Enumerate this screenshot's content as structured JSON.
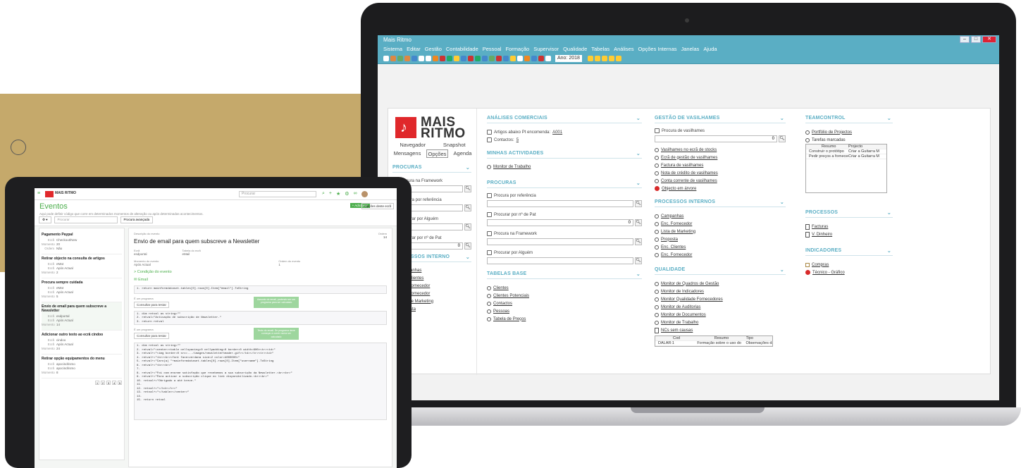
{
  "laptop": {
    "window_title": "Mais Ritmo",
    "menu": [
      "Sistema",
      "Editar",
      "Gestão",
      "Contabilidade",
      "Pessoal",
      "Formação",
      "Supervisor",
      "Qualidade",
      "Tabelas",
      "Análises",
      "Opções Internas",
      "Janelas",
      "Ajuda"
    ],
    "toolbar_year": "Ano: 2018",
    "logo": {
      "line1": "MAIS",
      "line2": "RITMO"
    },
    "left_tabs": {
      "row1": [
        "Navegador",
        "Snapshot"
      ],
      "row2": [
        "Mensagens",
        "Opções",
        "Agenda"
      ]
    },
    "procuras_title": "PROCURAS",
    "procuras": [
      {
        "label": "Procura na Framework",
        "value": ""
      },
      {
        "label": "Procura por referência",
        "value": ""
      },
      {
        "label": "Procurar por Alguém",
        "value": ""
      },
      {
        "label": "Procurar por nº de Pat",
        "value": "0"
      }
    ],
    "processos_interno_title": "PROCESSOS INTERNO",
    "processos_interno_items": [
      "Campanhas",
      "Enc. Clientes",
      "Enc. Fornecedor",
      "Enc. Fornecedor",
      "Lista de Marketing",
      "Proposta"
    ],
    "col1": {
      "analises_title": "ANÁLISES COMERCIAIS",
      "analises": [
        {
          "text": "Artigos abaixo Pt encomenda: ",
          "link": "A001"
        },
        {
          "text": "Contactos: ",
          "link": "5"
        }
      ],
      "minhas_title": "MINHAS ACTIVIDADES",
      "minhas": [
        "Monitor de Trabalho"
      ],
      "procuras_title": "PROCURAS",
      "procuras": [
        {
          "label": "Procura por referência",
          "value": ""
        },
        {
          "label": "Procurar por nº de Pat",
          "value": "0"
        },
        {
          "label": "Procura na Framework",
          "value": ""
        },
        {
          "label": "Procurar por Alguém",
          "value": ""
        }
      ],
      "tabelas_title": "TABELAS BASE",
      "tabelas": [
        "Clientes",
        "Clientes Potenciais",
        "Contactos",
        "Pessoas",
        "Tabela de Preços"
      ]
    },
    "col2": {
      "vasilhames_title": "GESTÃO DE VASILHAMES",
      "vasilhames_search_label": "Procura de vasilhames",
      "vasilhames_search_value": "0",
      "vasilhames": [
        "Vasilhames no ecrã de stocks",
        "Ecrã de gestão de vasilhames",
        "Factura de vasilhames",
        "Nota de crédito de vasilhames",
        "Conta corrente de vasilhames"
      ],
      "vasilhames_err": "Objecto em árvore",
      "processos_title": "PROCESSOS INTERNOS",
      "processos": [
        "Campanhas",
        "Enc. Fornecedor",
        "Lista de Marketing",
        "Proposta",
        "Enc. Clientes",
        "Enc. Fornecedor"
      ],
      "qualidade_title": "QUALIDADE",
      "qualidade": [
        "Monitor de Quadros de Gestão",
        "Monitor de Indicadores",
        "Monitor Qualidade Fornecedores",
        "Monitor de Auditorias",
        "Monitor de Documentos",
        "Monitor de Trabalho"
      ],
      "ncs_label": "NCs sem causas",
      "ncs_headers": [
        "Cod",
        "Resumo",
        "Tipo"
      ],
      "ncs_rows": [
        [
          "DALAR:1",
          "Formação sobre o uso do",
          "Observações da"
        ]
      ]
    },
    "col3": {
      "teamcontrol_title": "TEAMCONTROL",
      "portfolio": "Portfólio de Projectos",
      "tarefas": "Tarefas marcadas",
      "tarefas_headers": [
        "Resumo",
        "Projecto"
      ],
      "tarefas_rows": [
        [
          "Construir o protótipo",
          "Criar a Guitarra M"
        ],
        [
          "Pedir preços a fornecedor",
          "Criar a Guitarra M"
        ]
      ],
      "processos_title": "PROCESSOS",
      "processos": [
        "Facturas",
        "V. Dinheiro"
      ],
      "indicadores_title": "INDICADORES",
      "indicadores": [
        {
          "text": "Compras",
          "type": "doc"
        },
        {
          "text": "Técnico - Gráfico",
          "type": "err"
        }
      ]
    }
  },
  "tablet": {
    "brand": "MAIS RITMO",
    "search_placeholder": "Procurar",
    "page_title": "Eventos",
    "page_subtitle": "Aqui pode definir código que corre em determinados momentos de alteração ou após determinadas acontecimentos.",
    "btn_add": "+ Adicionar",
    "btn_options": "Opções deste ecrã",
    "filter_placeholder": "Procurar",
    "filter_btn": "Procura avançada",
    "events": [
      {
        "title": "Pagamento Paypal",
        "kv": [
          [
            "Ecrã",
            "Checkout/New"
          ],
          [
            "Momento",
            "20"
          ],
          [
            "Ordem",
            "Não"
          ]
        ]
      },
      {
        "title": "Retirar objecto na consulta de artigos",
        "kv": [
          [
            "Ecrã",
            "eMat"
          ],
          [
            "Ecrã",
            "Após Actual"
          ],
          [
            "Momento",
            "2"
          ]
        ]
      },
      {
        "title": "Procura sempre cuidada",
        "kv": [
          [
            "Ecrã",
            "eMat"
          ],
          [
            "Ecrã",
            "Após Actual"
          ],
          [
            "Momento",
            "5"
          ]
        ]
      },
      {
        "title": "Envio de email para quem subscreve a Newsletter",
        "kv": [
          [
            "Ecrã",
            "esdportal"
          ],
          [
            "Ecrã",
            "Após Actual"
          ],
          [
            "Momento",
            "14"
          ]
        ]
      },
      {
        "title": "Adicionar outro texto ao ecrã cindoo",
        "kv": [
          [
            "Ecrã",
            "cindoo"
          ],
          [
            "Ecrã",
            "Após Actual"
          ],
          [
            "Momento",
            "24"
          ]
        ]
      },
      {
        "title": "Retirar opção equipamentos do menu",
        "kv": [
          [
            "Ecrã",
            "apocindrismo"
          ],
          [
            "Ecrã",
            "apocindrismo"
          ],
          [
            "Momento",
            "8"
          ]
        ]
      }
    ],
    "pager": [
      "1",
      "2",
      "3",
      "4",
      "5"
    ],
    "detail": {
      "desc_label": "Descrição do evento",
      "title": "Envio de email para quem subscreve a Newsletter",
      "order_label": "Ordem",
      "order": "14",
      "screen_label": "Ecrã",
      "screen": "esdportal",
      "table_label": "Tabela do ecrã",
      "table": "eMail",
      "moment_label": "Momento do evento",
      "moment": "Após Actual",
      "type_label": "Ordem do evento",
      "type": "1",
      "condition": "Condição do evento",
      "email": "Email",
      "code1": "1. return mainformdataset.tables[0].rows[0].Item[\"email\"].ToString",
      "program_label": "É um programa",
      "consult_btn": "Consultar para testar",
      "code2": "1. dim retval as string=\"\"\n2. retval=\"Activação de subscrição de Newsletter.\"\n3. return retval",
      "badge1": "Assunto do email, podendo ser um programa para ser calculado",
      "badge2": "Texto do email. Se programa deve começar a correr numa ser calculado",
      "code3": "1. dim retval as string=\"\"\n2. retval=\"<center><table cellspacing=0 cellpadding=0 border=0 width=600><tr><td>\"\n3. retval+=\"<img border=0 src=.../images/newsletterheader.gif></td></tr><tr><td>\"\n4. retval+=\"<br><br><font face=verdana size=2 color=#000000>\"\n5. retval+=\"Caro(a) \"+mainformdataset.tables[0].rows[0].Item[\"username\"].ToString\n6. retval+=\"<br><br>\"\n7.\n8. retval+=\"Foi com enorme satisfação que recebemos a sua subscrição da Newsletter.<br><br>\"\n9. retval+=\"Para activar a subscrição clique no link disponibilizado.<br><br>\"\n10. retval+=\"Obrigado a até breve.\"\n11.\n12. retval+=\"</td></tr>\"\n13. retval+=\"</table></center>\"\n14.\n15. return retval"
    }
  }
}
